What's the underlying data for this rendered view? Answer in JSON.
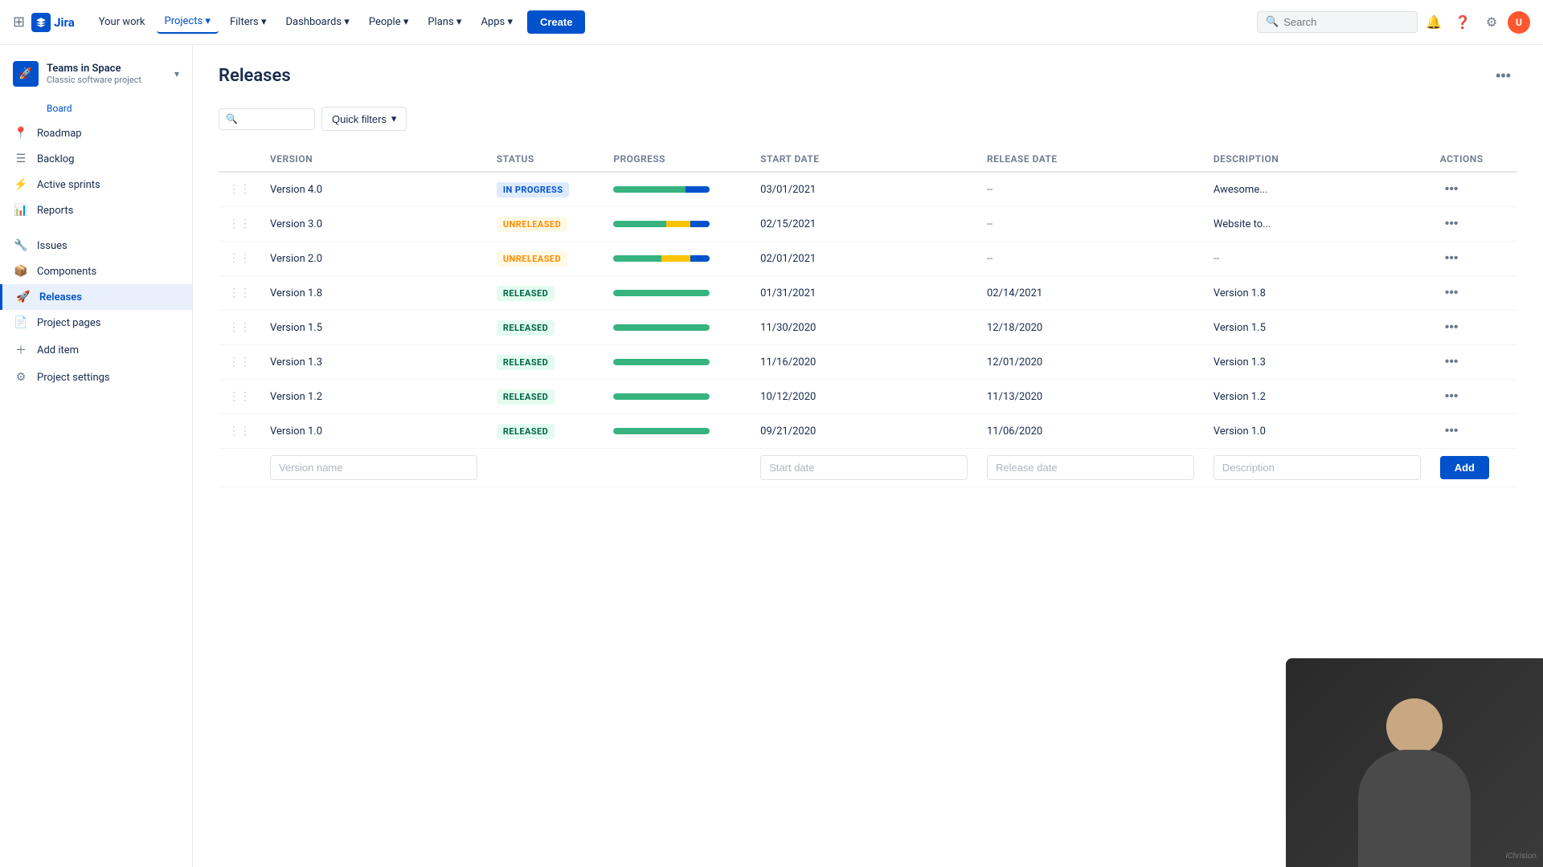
{
  "topnav": {
    "logo_text": "Jira",
    "nav_items": [
      {
        "label": "Your work",
        "active": false
      },
      {
        "label": "Projects",
        "active": true,
        "has_dropdown": true
      },
      {
        "label": "Filters",
        "active": false,
        "has_dropdown": true
      },
      {
        "label": "Dashboards",
        "active": false,
        "has_dropdown": true
      },
      {
        "label": "People",
        "active": false,
        "has_dropdown": true
      },
      {
        "label": "Plans",
        "active": false,
        "has_dropdown": true
      },
      {
        "label": "Apps",
        "active": false,
        "has_dropdown": true
      }
    ],
    "create_label": "Create",
    "search_placeholder": "Search",
    "avatar_initials": "U"
  },
  "sidebar": {
    "project_name": "Teams in Space",
    "project_type": "Classic software project",
    "board_link": "Board",
    "nav_items": [
      {
        "label": "Roadmap",
        "icon": "📍",
        "active": false
      },
      {
        "label": "Backlog",
        "icon": "☰",
        "active": false
      },
      {
        "label": "Active sprints",
        "icon": "⚡",
        "active": false
      },
      {
        "label": "Reports",
        "icon": "📊",
        "active": false
      },
      {
        "label": "Issues",
        "icon": "🔧",
        "active": false
      },
      {
        "label": "Components",
        "icon": "📦",
        "active": false
      },
      {
        "label": "Releases",
        "icon": "🚀",
        "active": true
      },
      {
        "label": "Project pages",
        "icon": "📄",
        "active": false
      },
      {
        "label": "Add item",
        "icon": "+",
        "active": false
      },
      {
        "label": "Project settings",
        "icon": "⚙",
        "active": false
      }
    ]
  },
  "page": {
    "title": "Releases",
    "more_icon": "•••"
  },
  "toolbar": {
    "search_placeholder": "",
    "quick_filters_label": "Quick filters",
    "quick_filters_dropdown_icon": "▾"
  },
  "table": {
    "columns": [
      "",
      "Version",
      "Status",
      "Progress",
      "Start date",
      "Release date",
      "Description",
      "Actions"
    ],
    "rows": [
      {
        "version": "Version 4.0",
        "status": "IN PROGRESS",
        "status_type": "in-progress",
        "progress": {
          "green": 75,
          "yellow": 0,
          "blue": 25
        },
        "start_date": "03/01/2021",
        "release_date": "--",
        "description": "Awesome...",
        "desc_dash": false
      },
      {
        "version": "Version 3.0",
        "status": "UNRELEASED",
        "status_type": "unreleased",
        "progress": {
          "green": 55,
          "yellow": 25,
          "blue": 20
        },
        "start_date": "02/15/2021",
        "release_date": "--",
        "description": "Website to...",
        "desc_dash": false
      },
      {
        "version": "Version 2.0",
        "status": "UNRELEASED",
        "status_type": "unreleased",
        "progress": {
          "green": 50,
          "yellow": 30,
          "blue": 20
        },
        "start_date": "02/01/2021",
        "release_date": "--",
        "description": "--",
        "desc_dash": true
      },
      {
        "version": "Version 1.8",
        "status": "RELEASED",
        "status_type": "released",
        "progress": {
          "green": 100,
          "yellow": 0,
          "blue": 0
        },
        "start_date": "01/31/2021",
        "release_date": "02/14/2021",
        "description": "Version 1.8",
        "desc_dash": false
      },
      {
        "version": "Version 1.5",
        "status": "RELEASED",
        "status_type": "released",
        "progress": {
          "green": 100,
          "yellow": 0,
          "blue": 0
        },
        "start_date": "11/30/2020",
        "release_date": "12/18/2020",
        "description": "Version 1.5",
        "desc_dash": false
      },
      {
        "version": "Version 1.3",
        "status": "RELEASED",
        "status_type": "released",
        "progress": {
          "green": 100,
          "yellow": 0,
          "blue": 0
        },
        "start_date": "11/16/2020",
        "release_date": "12/01/2020",
        "description": "Version 1.3",
        "desc_dash": false
      },
      {
        "version": "Version 1.2",
        "status": "RELEASED",
        "status_type": "released",
        "progress": {
          "green": 100,
          "yellow": 0,
          "blue": 0
        },
        "start_date": "10/12/2020",
        "release_date": "11/13/2020",
        "description": "Version 1.2",
        "desc_dash": false
      },
      {
        "version": "Version 1.0",
        "status": "RELEASED",
        "status_type": "released",
        "progress": {
          "green": 100,
          "yellow": 0,
          "blue": 0
        },
        "start_date": "09/21/2020",
        "release_date": "11/06/2020",
        "description": "Version 1.0",
        "desc_dash": false
      }
    ],
    "add_row": {
      "version_placeholder": "Version name",
      "start_date_placeholder": "Start date",
      "release_date_placeholder": "Release date",
      "description_placeholder": "Description",
      "add_button_label": "Add"
    }
  }
}
